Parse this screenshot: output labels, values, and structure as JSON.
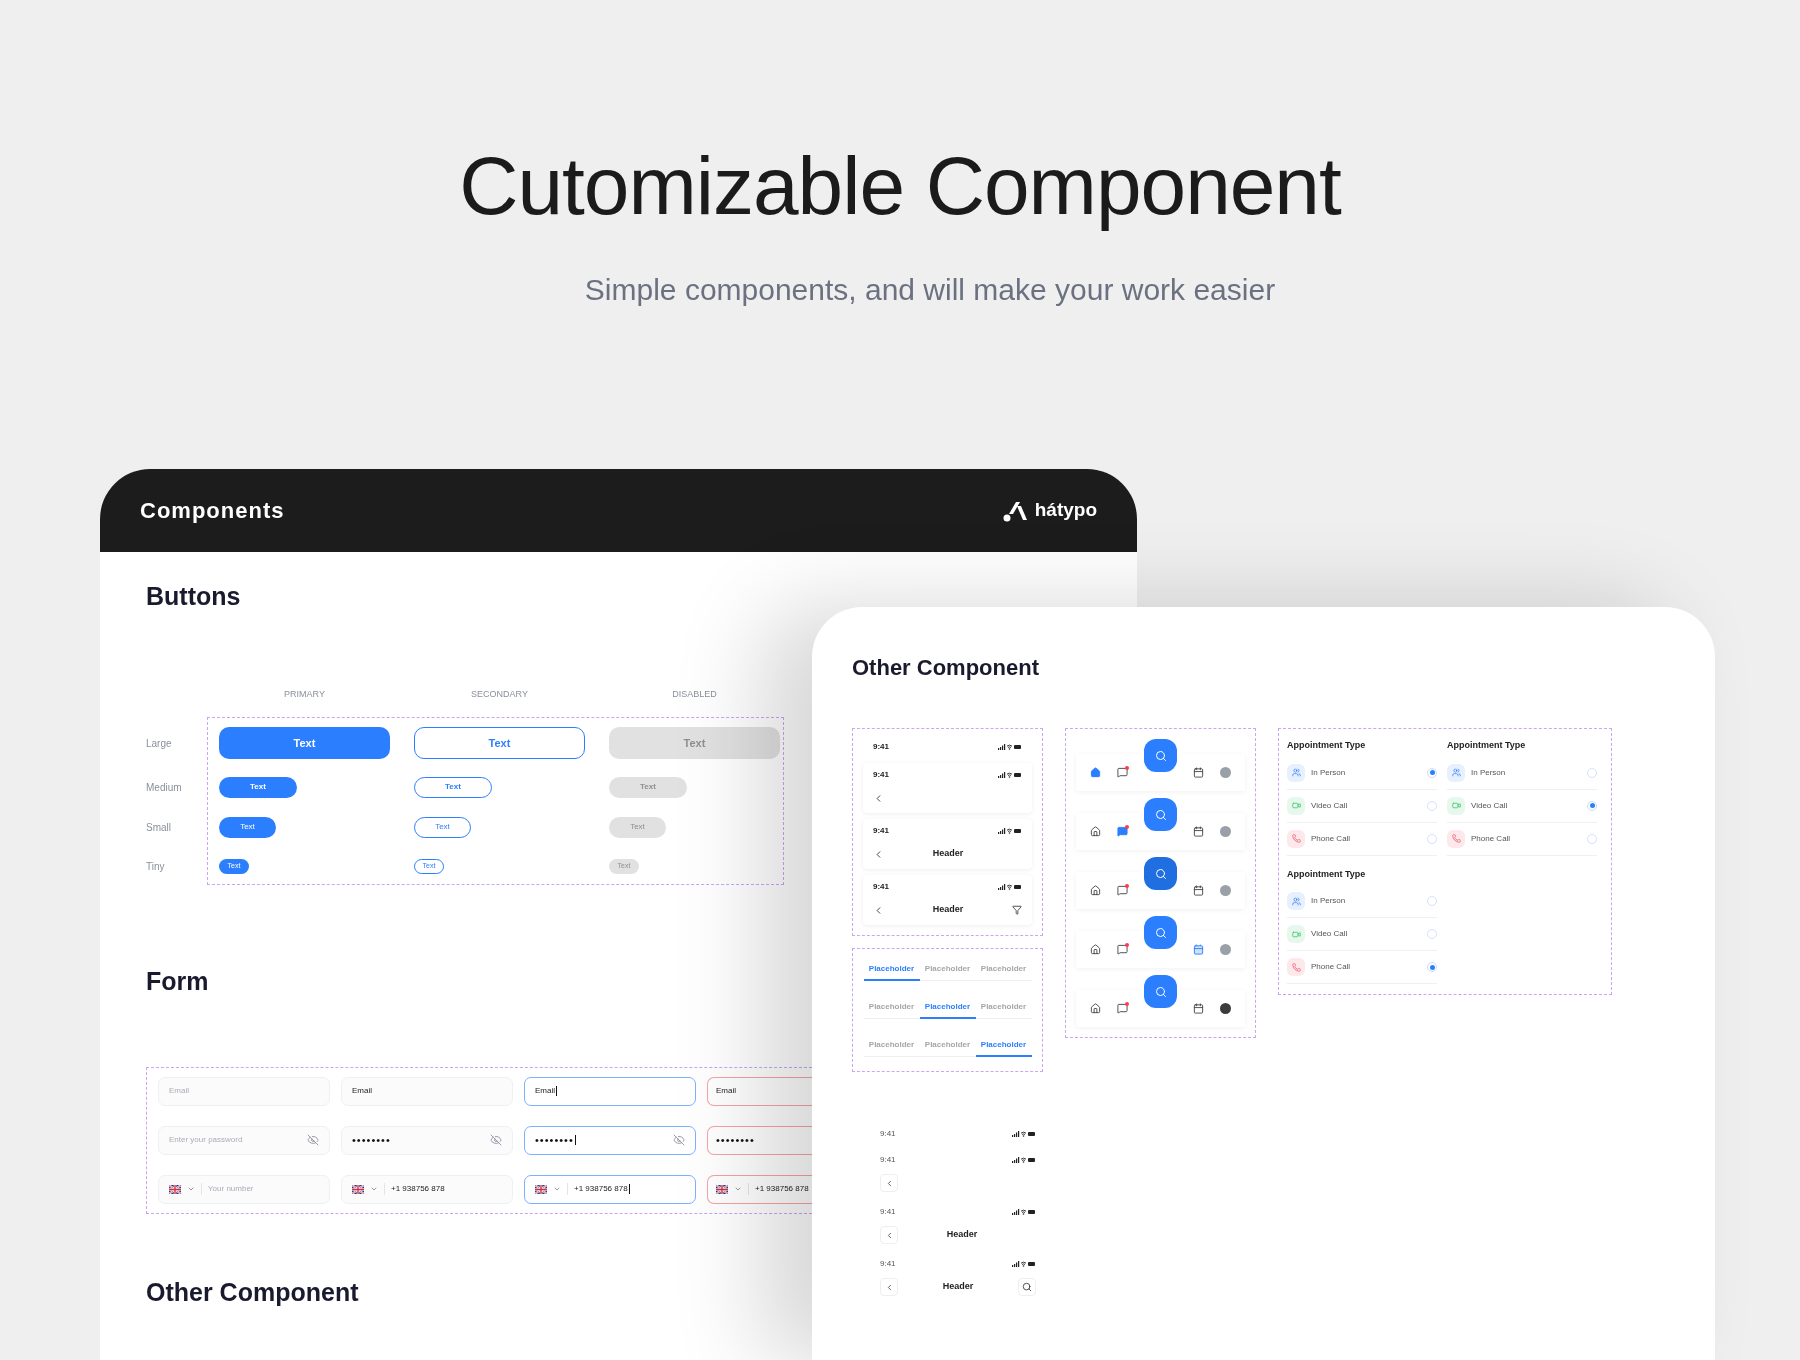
{
  "hero": {
    "title": "Cutomizable Component",
    "subtitle": "Simple components, and will make your work easier"
  },
  "components_panel": {
    "title": "Components",
    "brand": "hátypo",
    "buttons": {
      "title": "Buttons",
      "columns": [
        "PRIMARY",
        "SECONDARY",
        "DISABLED"
      ],
      "rows": [
        {
          "label": "Large",
          "buttons": [
            {
              "kind": "primary",
              "label": "Text"
            },
            {
              "kind": "secondary",
              "label": "Text"
            },
            {
              "kind": "disabled",
              "label": "Text"
            }
          ]
        },
        {
          "label": "Medium",
          "buttons": [
            {
              "kind": "primary",
              "label": "Text"
            },
            {
              "kind": "secondary",
              "label": "Text"
            },
            {
              "kind": "disabled",
              "label": "Text"
            }
          ]
        },
        {
          "label": "Small",
          "buttons": [
            {
              "kind": "primary",
              "label": "Text"
            },
            {
              "kind": "secondary",
              "label": "Text"
            },
            {
              "kind": "disabled",
              "label": "Text"
            }
          ]
        },
        {
          "label": "Tiny",
          "buttons": [
            {
              "kind": "primary",
              "label": "Text"
            },
            {
              "kind": "secondary",
              "label": "Text"
            },
            {
              "kind": "disabled",
              "label": "Text"
            }
          ]
        }
      ]
    },
    "form": {
      "title": "Form",
      "rows": [
        {
          "kind": "email",
          "fields": [
            {
              "placeholder": "Email",
              "focused": false,
              "error": false
            },
            {
              "value": "Email",
              "focused": false,
              "error": false
            },
            {
              "value": "Email",
              "focused": true,
              "error": false
            },
            {
              "value": "Email",
              "focused": false,
              "error": true
            }
          ]
        },
        {
          "kind": "password",
          "fields": [
            {
              "placeholder": "Enter your password",
              "focused": false,
              "error": false
            },
            {
              "value": "••••••••",
              "focused": false,
              "error": false
            },
            {
              "value": "••••••••",
              "focused": true,
              "error": false
            },
            {
              "value": "••••••••",
              "focused": false,
              "error": true
            }
          ]
        },
        {
          "kind": "phone",
          "fields": [
            {
              "placeholder": "Your number",
              "focused": false,
              "error": false
            },
            {
              "value": "+1 938756 878",
              "focused": false,
              "error": false
            },
            {
              "value": "+1 938756 878",
              "focused": true,
              "error": false
            },
            {
              "value": "+1 938756 878",
              "focused": false,
              "error": true
            }
          ]
        }
      ]
    },
    "other_title": "Other Component"
  },
  "other_panel": {
    "title": "Other Component",
    "status_bars": [
      {
        "time": "9:41",
        "back": false
      },
      {
        "time": "9:41",
        "back": true
      },
      {
        "time": "9:41",
        "back": true,
        "title": "Header"
      },
      {
        "time": "9:41",
        "back": true,
        "title": "Header",
        "action": {
          "kind": "filter"
        }
      }
    ],
    "tab_groups": [
      {
        "tabs": [
          {
            "label": "Placeholder",
            "selected": true
          },
          {
            "label": "Placeholder",
            "selected": false
          },
          {
            "label": "Placeholder",
            "selected": false
          }
        ]
      },
      {
        "tabs": [
          {
            "label": "Placeholder",
            "selected": false
          },
          {
            "label": "Placeholder",
            "selected": true
          },
          {
            "label": "Placeholder",
            "selected": false
          }
        ]
      },
      {
        "tabs": [
          {
            "label": "Placeholder",
            "selected": false
          },
          {
            "label": "Placeholder",
            "selected": false
          },
          {
            "label": "Placeholder",
            "selected": true
          }
        ]
      }
    ],
    "nav_bars": [
      {
        "items": [
          {
            "kind": "home",
            "selected": true
          },
          {
            "kind": "chat",
            "selected": false
          },
          {
            "kind": "search",
            "selected": false
          },
          {
            "kind": "calendar",
            "selected": false
          },
          {
            "kind": "avatar",
            "selected": false
          }
        ]
      },
      {
        "items": [
          {
            "kind": "home",
            "selected": false
          },
          {
            "kind": "chat",
            "selected": true
          },
          {
            "kind": "search",
            "selected": false
          },
          {
            "kind": "calendar",
            "selected": false
          },
          {
            "kind": "avatar",
            "selected": false
          }
        ]
      },
      {
        "items": [
          {
            "kind": "home",
            "selected": false
          },
          {
            "kind": "chat",
            "selected": false
          },
          {
            "kind": "search",
            "selected": true
          },
          {
            "kind": "calendar",
            "selected": false
          },
          {
            "kind": "avatar",
            "selected": false
          }
        ]
      },
      {
        "items": [
          {
            "kind": "home",
            "selected": false
          },
          {
            "kind": "chat",
            "selected": false
          },
          {
            "kind": "search",
            "selected": false
          },
          {
            "kind": "calendar",
            "selected": true
          },
          {
            "kind": "avatar",
            "selected": false
          }
        ]
      },
      {
        "items": [
          {
            "kind": "home",
            "selected": false
          },
          {
            "kind": "chat",
            "selected": false
          },
          {
            "kind": "search",
            "selected": false
          },
          {
            "kind": "calendar",
            "selected": false
          },
          {
            "kind": "avatar",
            "selected": true
          }
        ]
      }
    ],
    "appointment_groups": [
      {
        "title": "Appointment Type",
        "options": [
          {
            "kind": "person",
            "label": "In Person",
            "selected": true
          },
          {
            "kind": "video",
            "label": "Video Call",
            "selected": false
          },
          {
            "kind": "phone",
            "label": "Phone Call",
            "selected": false
          }
        ]
      },
      {
        "title": "Appointment Type",
        "options": [
          {
            "kind": "person",
            "label": "In Person",
            "selected": false
          },
          {
            "kind": "video",
            "label": "Video Call",
            "selected": true
          },
          {
            "kind": "phone",
            "label": "Phone Call",
            "selected": false
          }
        ]
      },
      {
        "title": "Appointment Type",
        "options": [
          {
            "kind": "person",
            "label": "In Person",
            "selected": false
          },
          {
            "kind": "video",
            "label": "Video Call",
            "selected": false
          },
          {
            "kind": "phone",
            "label": "Phone Call",
            "selected": true
          }
        ]
      }
    ],
    "compact_status_bars": [
      {
        "time": "9:41",
        "back": false
      },
      {
        "time": "9:41",
        "back": true
      },
      {
        "time": "9:41",
        "back": true,
        "title": "Header"
      },
      {
        "time": "9:41",
        "back": true,
        "title": "Header",
        "action": {
          "kind": "search"
        }
      }
    ]
  }
}
